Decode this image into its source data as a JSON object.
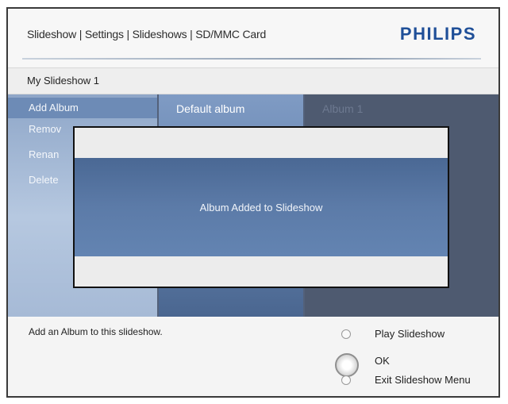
{
  "header": {
    "breadcrumb": "Slideshow | Settings | Slideshows | SD/MMC Card",
    "brand": "PHILIPS",
    "subtitle": "My Slideshow 1"
  },
  "menu": {
    "items": [
      {
        "label": "Add Album"
      },
      {
        "label": "Remov"
      },
      {
        "label": "Renan"
      },
      {
        "label": "Delete"
      }
    ]
  },
  "albums": {
    "middle": "Default album",
    "right": "Album 1"
  },
  "dialog": {
    "message": "Album Added to Slideshow"
  },
  "footer": {
    "help": "Add an Album to this slideshow.",
    "controls": {
      "play": "Play Slideshow",
      "ok": "OK",
      "exit": "Exit Slideshow Menu"
    }
  }
}
